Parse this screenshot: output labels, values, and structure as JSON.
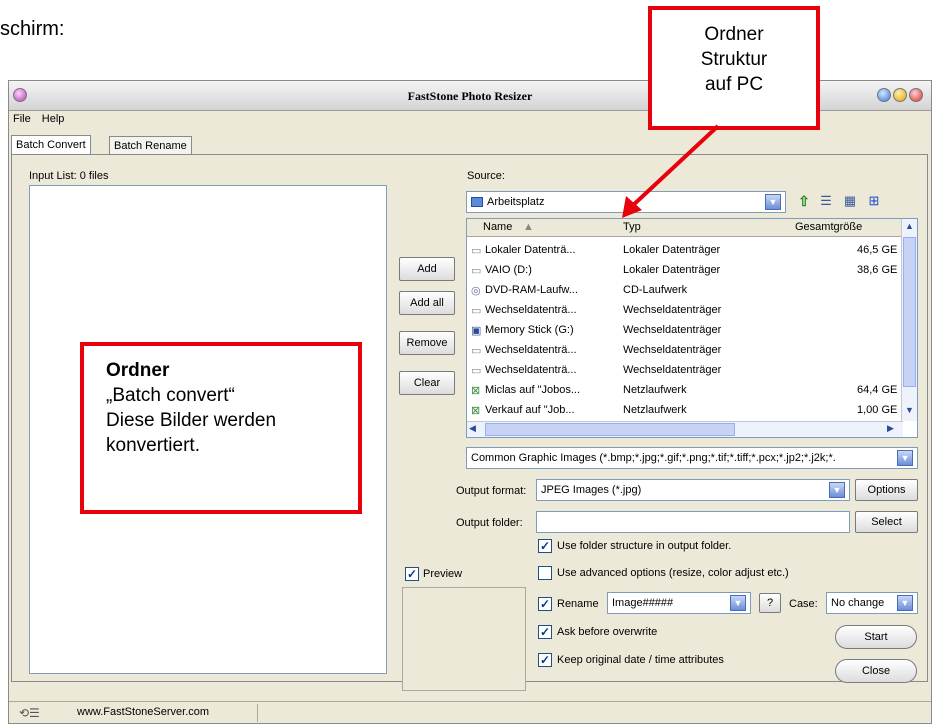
{
  "doc_text": "schirm:",
  "window": {
    "title": "FastStone Photo Resizer",
    "menu": [
      "File",
      "Help"
    ],
    "tabs": [
      "Batch Convert",
      "Batch Rename"
    ]
  },
  "input_list": {
    "label": "Input List:  0 files"
  },
  "buttons": {
    "add": "Add",
    "add_all": "Add all",
    "remove": "Remove",
    "clear": "Clear",
    "options": "Options",
    "select": "Select",
    "start": "Start",
    "close": "Close"
  },
  "source": {
    "label": "Source:",
    "location": "Arbeitsplatz",
    "columns": {
      "name": "Name",
      "type": "Typ",
      "size": "Gesamtgröße"
    },
    "rows": [
      {
        "name": "Lokaler Datenträ...",
        "type": "Lokaler Datenträger",
        "size": "46,5 GE",
        "icon": "drive-icon"
      },
      {
        "name": "VAIO (D:)",
        "type": "Lokaler Datenträger",
        "size": "38,6 GE",
        "icon": "drive-icon"
      },
      {
        "name": "DVD-RAM-Laufw...",
        "type": "CD-Laufwerk",
        "size": "",
        "icon": "dvd-icon"
      },
      {
        "name": "Wechseldatenträ...",
        "type": "Wechseldatenträger",
        "size": "",
        "icon": "drive-icon"
      },
      {
        "name": "Memory Stick (G:)",
        "type": "Wechseldatenträger",
        "size": "",
        "icon": "memory-stick-icon"
      },
      {
        "name": "Wechseldatenträ...",
        "type": "Wechseldatenträger",
        "size": "",
        "icon": "drive-icon"
      },
      {
        "name": "Wechseldatenträ...",
        "type": "Wechseldatenträger",
        "size": "",
        "icon": "drive-icon"
      },
      {
        "name": "Miclas auf \"Jobos...",
        "type": "Netzlaufwerk",
        "size": "64,4 GE",
        "icon": "network-drive-icon"
      },
      {
        "name": "Verkauf auf \"Job...",
        "type": "Netzlaufwerk",
        "size": "1,00 GE",
        "icon": "network-drive-icon"
      }
    ],
    "filter": "Common Graphic Images (*.bmp;*.jpg;*.gif;*.png;*.tif;*.tiff;*.pcx;*.jp2;*.j2k;*."
  },
  "output": {
    "format_label": "Output format:",
    "format_value": "JPEG Images (*.jpg)",
    "folder_label": "Output folder:",
    "folder_value": ""
  },
  "options": {
    "use_folder_structure": "Use folder structure in output folder.",
    "advanced": "Use advanced options (resize, color adjust etc.)",
    "rename": "Rename",
    "rename_pattern": "Image#####",
    "help": "?",
    "case_label": "Case:",
    "case_value": "No change",
    "ask_overwrite": "Ask before overwrite",
    "keep_date": "Keep original date / time attributes",
    "preview": "Preview"
  },
  "status": {
    "url": "www.FastStoneServer.com"
  },
  "callouts": {
    "top_line1": "Ordner",
    "top_line2": "Struktur",
    "top_line3": "auf PC",
    "left_title": "Ordner",
    "left_line1": "„Batch convert“",
    "left_line2": "Diese Bilder werden",
    "left_line3": "konvertiert."
  },
  "colors": {
    "callout_red": "#e8000a",
    "window_bg": "#ece9d8",
    "listview_border": "#7f9db9"
  }
}
